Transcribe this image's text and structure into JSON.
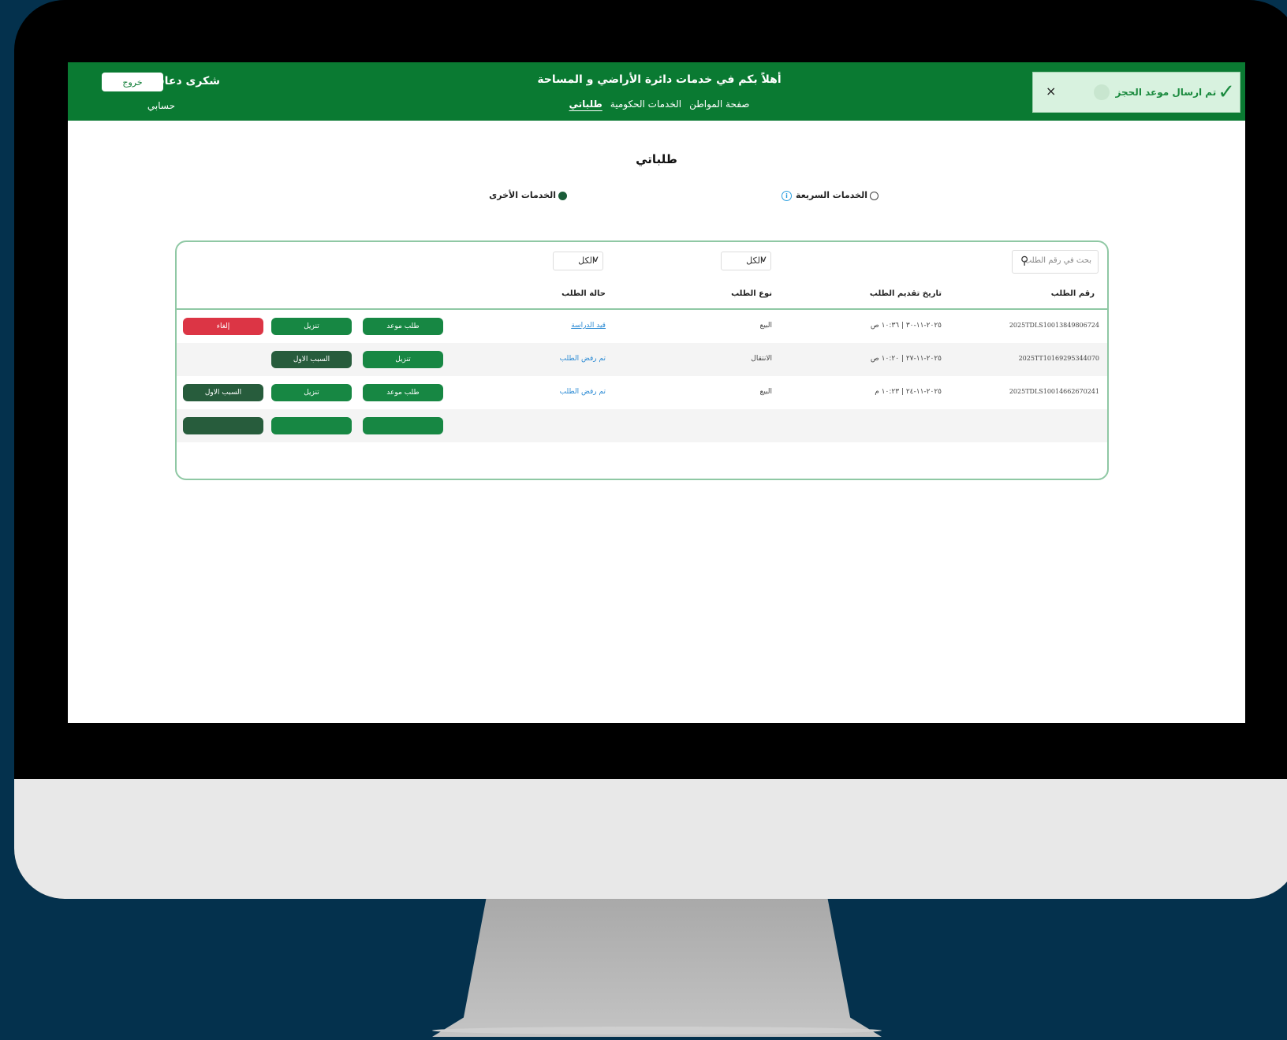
{
  "header": {
    "welcome": "أهلاً بكم في خدمات  دائرة  الأراضي و المساحة",
    "nav": [
      "صفحة المواطن",
      "الخدمات الحكومية",
      "طلباتي"
    ],
    "user_name": "شكرى دعاس",
    "logout_label": "خروج",
    "my_account": "حسابي"
  },
  "toast": {
    "message": "تم ارسال موعد الحجز",
    "close": "×"
  },
  "page": {
    "title": "طلباتي",
    "tabs": [
      {
        "label": "الخدمات السريعة",
        "selected": false
      },
      {
        "label": "الخدمات الأخرى",
        "selected": true
      }
    ]
  },
  "filters": {
    "search_placeholder": "بحث في رقم الطلب",
    "type_filter": "الكل",
    "status_filter": "الكل"
  },
  "table": {
    "columns": [
      "رقم الطلب",
      "تاريخ تقديم الطلب",
      "نوع الطلب",
      "حالة الطلب"
    ],
    "rows": [
      {
        "id": "2025TDLS10013849806724",
        "date": "٢٠٢٥-١١-٣٠ | ١٠:٣٦ ص",
        "type": "البيع",
        "status": "قيد الدراسة",
        "actions": [
          "طلب موعد",
          "تنزيل",
          "إلغاء"
        ]
      },
      {
        "id": "2025TT10169295344070",
        "date": "٢٠٢٥-١١-٢٧ | ١٠:٢٠ ص",
        "type": "الانتقال",
        "status": "تم رفض الطلب",
        "actions": [
          "تنزيل",
          "السبب الاول"
        ]
      },
      {
        "id": "2025TDLS10014662670241",
        "date": "٢٠٢٥-١١-٢٤ | ١٠:٢٣ م",
        "type": "البيع",
        "status": "تم رفض الطلب",
        "actions": [
          "طلب موعد",
          "تنزيل",
          "السبب الاول"
        ]
      }
    ]
  },
  "colors": {
    "header_green": "#0a7a32",
    "button_green": "#178743",
    "button_dark": "#275c3c",
    "button_red": "#dc3545",
    "link_blue": "#2a8ad4",
    "background": "#04314d"
  }
}
